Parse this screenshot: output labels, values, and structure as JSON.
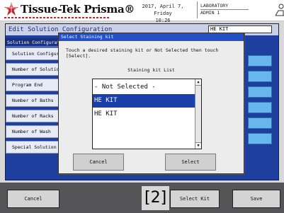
{
  "header": {
    "logo_text": "Tissue-Tek Prisma®",
    "date": "2017, April 7, Friday",
    "time": "10:26",
    "location": "LABORATORY",
    "user": "ADMIN 1",
    "brand_color": "#c1272d"
  },
  "panel": {
    "title": "Edit Solution Configuration",
    "kit_value": "HE KIT",
    "list_header": "Solution Configuration",
    "items": [
      {
        "label": "Solution Configuration"
      },
      {
        "label": "Number of Solutions"
      },
      {
        "label": "Program End"
      },
      {
        "label": "Number of Baths"
      },
      {
        "label": "Number of Racks"
      },
      {
        "label": "Number of Wash"
      },
      {
        "label": "Special Solution"
      }
    ]
  },
  "modal": {
    "title": "Select Staining kit",
    "instruction": "Touch a desired staining kit or Not Selected then touch [Select].",
    "list_caption": "Staining kit List",
    "options": [
      {
        "label": "- Not Selected -",
        "selected": false
      },
      {
        "label": "HE KIT",
        "selected": true
      },
      {
        "label": "HE KIT",
        "selected": false
      }
    ],
    "cancel_label": "Cancel",
    "select_label": "Select"
  },
  "footer": {
    "cancel_label": "Cancel",
    "select_kit_label": "Select Kit",
    "save_label": "Save"
  },
  "annotation": "[2]",
  "colors": {
    "panel_blue": "#1f3f9e",
    "selection_blue": "#1b3fa8",
    "modal_title_blue": "#2150c8",
    "side_button": "#67b6ee"
  }
}
